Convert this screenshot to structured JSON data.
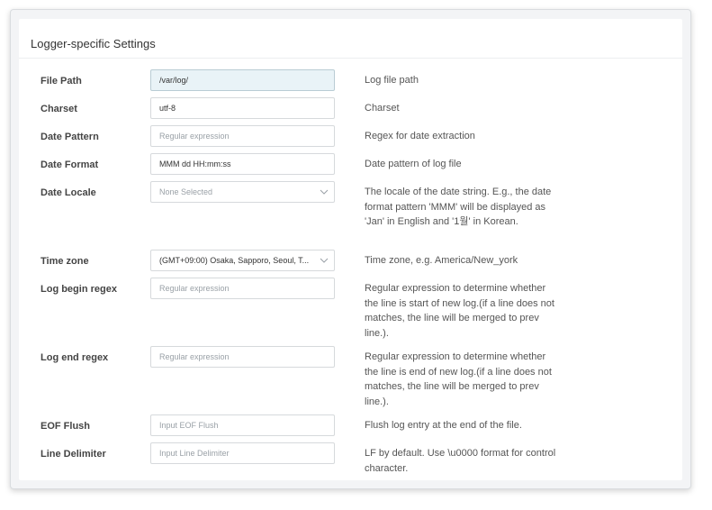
{
  "panel": {
    "title": "Logger-specific Settings"
  },
  "rows": [
    {
      "label": "File Path",
      "value": "/var/log/",
      "placeholder": "",
      "description": "Log file path"
    },
    {
      "label": "Charset",
      "value": "utf-8",
      "placeholder": "",
      "description": "Charset"
    },
    {
      "label": "Date Pattern",
      "value": "",
      "placeholder": "Regular expression",
      "description": "Regex for date extraction"
    },
    {
      "label": "Date Format",
      "value": "MMM dd HH:mm:ss",
      "placeholder": "",
      "description": "Date pattern of log file"
    },
    {
      "label": "Date Locale",
      "value": "",
      "placeholder": "None Selected",
      "description": "The locale of the date string. E.g., the date format pattern 'MMM' will be displayed as 'Jan' in English and '1월' in Korean."
    },
    {
      "label": "Time zone",
      "value": "(GMT+09:00) Osaka, Sapporo, Seoul, T...",
      "placeholder": "",
      "description": "Time zone, e.g. America/New_york"
    },
    {
      "label": "Log begin regex",
      "value": "",
      "placeholder": "Regular expression",
      "description": "Regular expression to determine whether the line is start of new log.(if a line does not matches, the line will be merged to prev line.)."
    },
    {
      "label": "Log end regex",
      "value": "",
      "placeholder": "Regular expression",
      "description": "Regular expression to determine whether the line is end of new log.(if a line does not matches, the line will be merged to prev line.)."
    },
    {
      "label": "EOF Flush",
      "value": "",
      "placeholder": "Input EOF Flush",
      "description": "Flush log entry at the end of the file."
    },
    {
      "label": "Line Delimiter",
      "value": "",
      "placeholder": "Input Line Delimiter",
      "description": "LF by default. Use \\u0000 format for control character."
    }
  ],
  "icons": {
    "select_arrow": "chevron-down-icon"
  }
}
